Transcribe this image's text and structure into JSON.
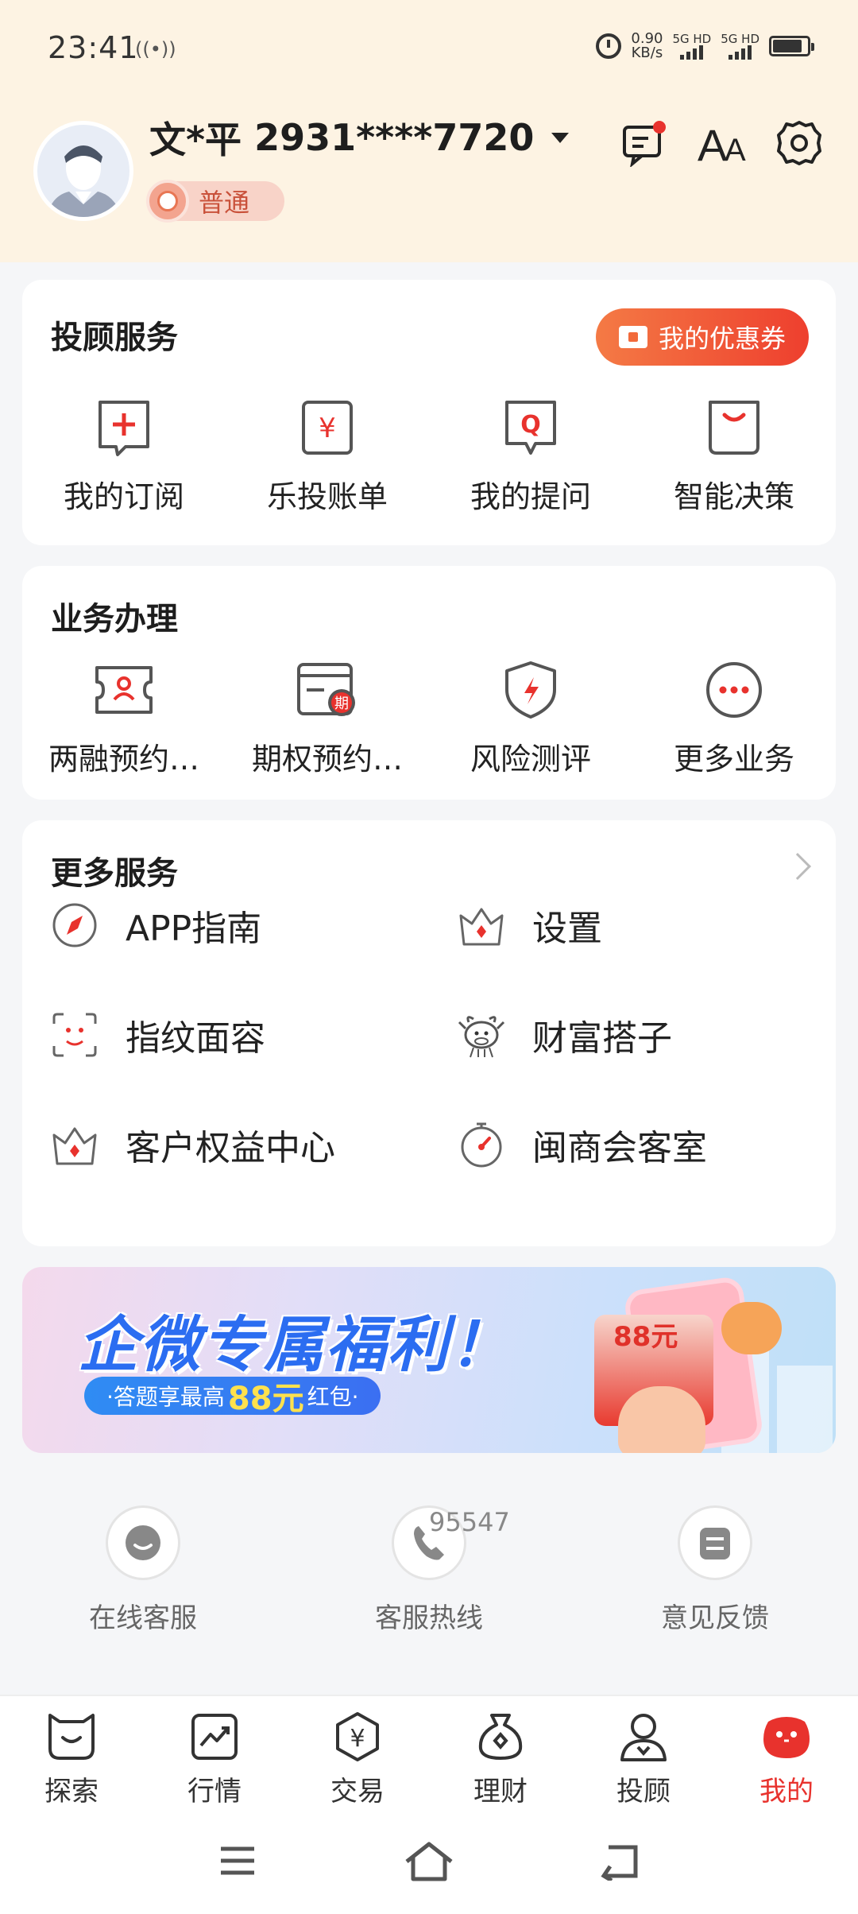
{
  "status_bar": {
    "time": "23:41",
    "net_speed_value": "0.90",
    "net_speed_unit": "KB/s",
    "sim1": "5G HD",
    "sim2": "5G HD"
  },
  "profile": {
    "name": "文*平",
    "account": "2931****7720",
    "level": "普通"
  },
  "header_icons": [
    "messages-icon",
    "font-size-icon",
    "settings-icon"
  ],
  "advisory": {
    "title": "投顾服务",
    "coupon_button": "我的优惠券",
    "items": [
      {
        "label": "我的订阅",
        "icon": "subscribe-icon"
      },
      {
        "label": "乐投账单",
        "icon": "bill-icon"
      },
      {
        "label": "我的提问",
        "icon": "question-icon"
      },
      {
        "label": "智能决策",
        "icon": "smart-decision-icon"
      }
    ]
  },
  "business": {
    "title": "业务办理",
    "items": [
      {
        "label": "两融预约…",
        "icon": "margin-booking-icon"
      },
      {
        "label": "期权预约…",
        "icon": "options-booking-icon"
      },
      {
        "label": "风险测评",
        "icon": "risk-assessment-icon"
      },
      {
        "label": "更多业务",
        "icon": "more-business-icon"
      }
    ]
  },
  "more_services": {
    "title": "更多服务",
    "items": [
      {
        "label": "APP指南",
        "icon": "compass-icon"
      },
      {
        "label": "设置",
        "icon": "crown-icon"
      },
      {
        "label": "指纹面容",
        "icon": "face-id-icon"
      },
      {
        "label": "财富搭子",
        "icon": "cow-mascot-icon"
      },
      {
        "label": "客户权益中心",
        "icon": "crown-icon"
      },
      {
        "label": "闽商会客室",
        "icon": "timer-icon"
      }
    ]
  },
  "banner": {
    "title": "企微专属福利！",
    "subtitle_prefix": "·答题享最高",
    "subtitle_amount": "88元",
    "subtitle_suffix": "红包·",
    "packet_amount": "88元"
  },
  "support": {
    "items": [
      {
        "label": "在线客服",
        "icon": "chat-bubble-icon"
      },
      {
        "label": "客服热线",
        "icon": "phone-icon"
      },
      {
        "label": "意见反馈",
        "icon": "feedback-icon"
      }
    ],
    "hotline_number": "95547"
  },
  "bottom_nav": {
    "active_color": "#e8322d",
    "items": [
      {
        "label": "探索",
        "icon": "explore-icon"
      },
      {
        "label": "行情",
        "icon": "market-icon"
      },
      {
        "label": "交易",
        "icon": "trade-icon"
      },
      {
        "label": "理财",
        "icon": "wealth-icon"
      },
      {
        "label": "投顾",
        "icon": "advisor-icon"
      },
      {
        "label": "我的",
        "icon": "mine-icon"
      }
    ]
  }
}
